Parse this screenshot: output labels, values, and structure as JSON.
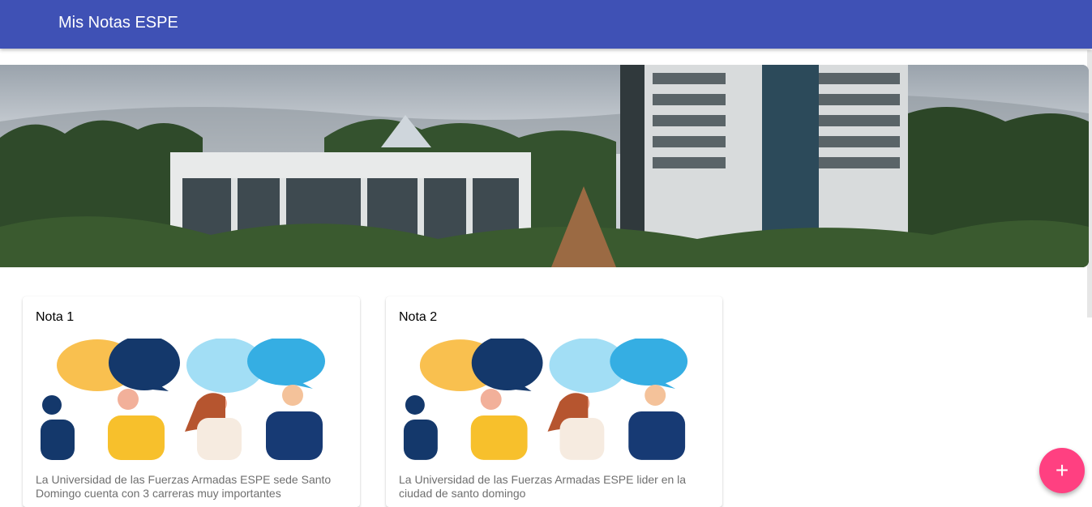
{
  "app": {
    "title": "Mis Notas ESPE"
  },
  "hero": {
    "image": "campus-photo"
  },
  "notes": [
    {
      "title": "Nota 1",
      "image": "people-speech-bubbles-illustration",
      "text": "La Universidad de las Fuerzas Armadas ESPE sede Santo Domingo cuenta con 3 carreras muy importantes"
    },
    {
      "title": "Nota 2",
      "image": "people-speech-bubbles-illustration",
      "text": "La Universidad de las Fuerzas Armadas ESPE lider en la ciudad de santo domingo"
    }
  ],
  "fab": {
    "label": "+",
    "icon": "plus-icon",
    "color": "#ff4081"
  },
  "colors": {
    "toolbar": "#3f51b5",
    "fab": "#ff4081"
  }
}
